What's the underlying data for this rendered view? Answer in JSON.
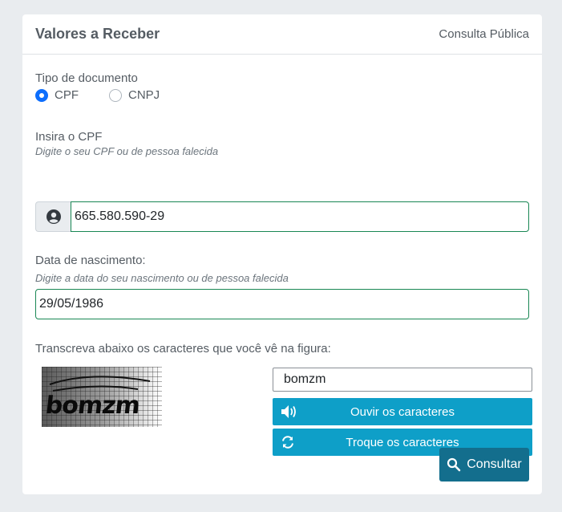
{
  "header": {
    "title": "Valores a Receber",
    "subtitle": "Consulta Pública"
  },
  "doc_type": {
    "label": "Tipo de documento",
    "options": [
      {
        "label": "CPF",
        "checked": true
      },
      {
        "label": "CNPJ",
        "checked": false
      }
    ]
  },
  "cpf": {
    "label": "Insira o CPF",
    "hint": "Digite o seu CPF ou de pessoa falecida",
    "value": "665.580.590-29",
    "icon": "user-circle-icon"
  },
  "birth": {
    "label": "Data de nascimento:",
    "hint": "Digite a data do seu nascimento ou de pessoa falecida",
    "value": "29/05/1986"
  },
  "captcha": {
    "label": "Transcreva abaixo os caracteres que você vê na figura:",
    "image_text": "bomzm",
    "input_value": "bomzm",
    "listen_label": "Ouvir os caracteres",
    "refresh_label": "Troque os caracteres",
    "colors": {
      "button": "#0e9fc8"
    }
  },
  "submit": {
    "label": "Consultar",
    "color": "#136e8d"
  }
}
